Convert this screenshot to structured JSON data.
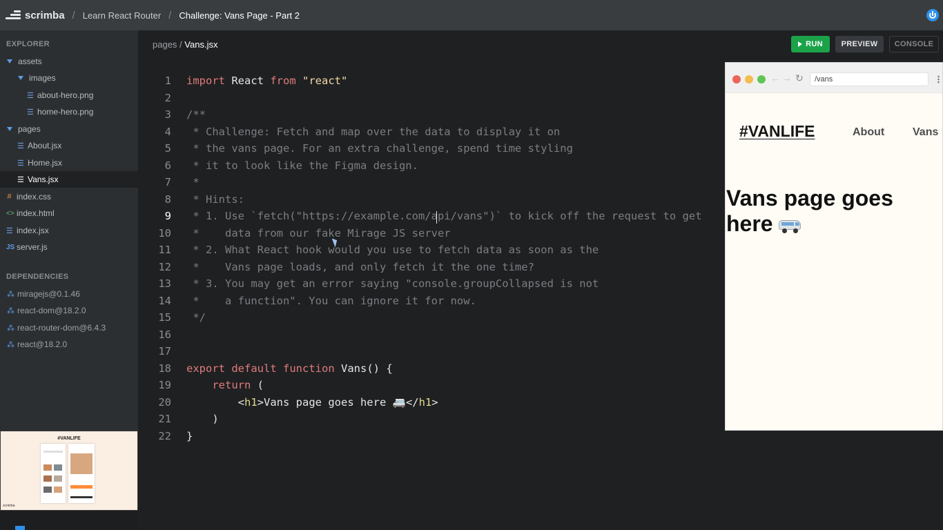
{
  "topbar": {
    "logo_text": "scrimba",
    "breadcrumbs": [
      "Learn React Router",
      "Challenge: Vans Page - Part 2"
    ]
  },
  "sidebar": {
    "explorer_label": "EXPLORER",
    "tree": [
      {
        "label": "assets",
        "kind": "folder"
      },
      {
        "label": "images",
        "kind": "folder"
      },
      {
        "label": "about-hero.png",
        "kind": "file-doc"
      },
      {
        "label": "home-hero.png",
        "kind": "file-doc"
      },
      {
        "label": "pages",
        "kind": "folder"
      },
      {
        "label": "About.jsx",
        "kind": "file-doc"
      },
      {
        "label": "Home.jsx",
        "kind": "file-doc"
      },
      {
        "label": "Vans.jsx",
        "kind": "file-doc",
        "selected": true
      },
      {
        "label": "index.css",
        "kind": "file-css"
      },
      {
        "label": "index.html",
        "kind": "file-html"
      },
      {
        "label": "index.jsx",
        "kind": "file-doc"
      },
      {
        "label": "server.js",
        "kind": "file-js"
      }
    ],
    "dependencies_label": "DEPENDENCIES",
    "dependencies": [
      "miragejs@0.1.46",
      "react-dom@18.2.0",
      "react-router-dom@6.4.3",
      "react@18.2.0"
    ],
    "thumbnail_title": "#VANLIFE",
    "thumbnail_brand": "scrimba"
  },
  "editor": {
    "path_folder": "pages",
    "path_sep": "/",
    "path_file": "Vans.jsx",
    "buttons": {
      "run": "RUN",
      "preview": "PREVIEW",
      "console": "CONSOLE"
    },
    "active_line": 9,
    "lines": [
      "import React from \"react\"",
      "",
      "/**",
      " * Challenge: Fetch and map over the data to display it on",
      " * the vans page. For an extra challenge, spend time styling",
      " * it to look like the Figma design.",
      " *",
      " * Hints:",
      " * 1. Use `fetch(\"https://example.com/api/vans\")` to kick off the request to get",
      " *    data from our fake Mirage JS server",
      " * 2. What React hook would you use to fetch data as soon as the",
      " *    Vans page loads, and only fetch it the one time?",
      " * 3. You may get an error saying \"console.groupCollapsed is not",
      " *    a function\". You can ignore it for now.",
      " */",
      "",
      "",
      "export default function Vans() {",
      "    return (",
      "        <h1>Vans page goes here 🚐</h1>",
      "    )",
      "}"
    ]
  },
  "preview": {
    "url": "/vans",
    "logo": "#VANLIFE",
    "nav": [
      "About",
      "Vans"
    ],
    "heading": "Vans page goes here"
  },
  "colors": {
    "topbar": "#3a3d40",
    "sidebar": "#2c2f32",
    "editor_bg": "#1f2022",
    "run_button": "#1ca34a",
    "keyword": "#e07b7b",
    "string": "#efd9a8",
    "comment": "#7b7e82"
  }
}
